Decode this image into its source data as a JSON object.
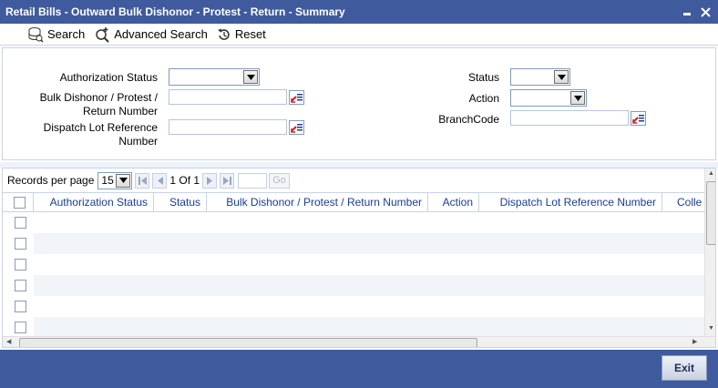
{
  "window": {
    "title": "Retail Bills - Outward Bulk Dishonor - Protest - Return - Summary",
    "minimize_glyph": "▄",
    "close_glyph": "✕"
  },
  "toolbar": {
    "search_label": "Search",
    "advanced_search_label": "Advanced Search",
    "reset_label": "Reset"
  },
  "criteria": {
    "authorization_status_label": "Authorization Status",
    "bulk_dishonor_label_line1": "Bulk Dishonor / Protest /",
    "bulk_dishonor_label_line2": "Return Number",
    "dispatch_lot_label_line1": "Dispatch Lot Reference",
    "dispatch_lot_label_line2": "Number",
    "status_label": "Status",
    "action_label": "Action",
    "branch_code_label": "BranchCode"
  },
  "pager": {
    "records_per_page_label": "Records per page",
    "records_per_page_value": "15",
    "page_info": "1 Of 1",
    "go_label": "Go"
  },
  "grid": {
    "columns": [
      "Authorization Status",
      "Status",
      "Bulk Dishonor / Protest / Return Number",
      "Action",
      "Dispatch Lot Reference Number",
      "Colle"
    ]
  },
  "footer": {
    "exit_label": "Exit"
  },
  "colors": {
    "titlebar": "#3f5b9e",
    "header_text": "#1a3e91"
  }
}
